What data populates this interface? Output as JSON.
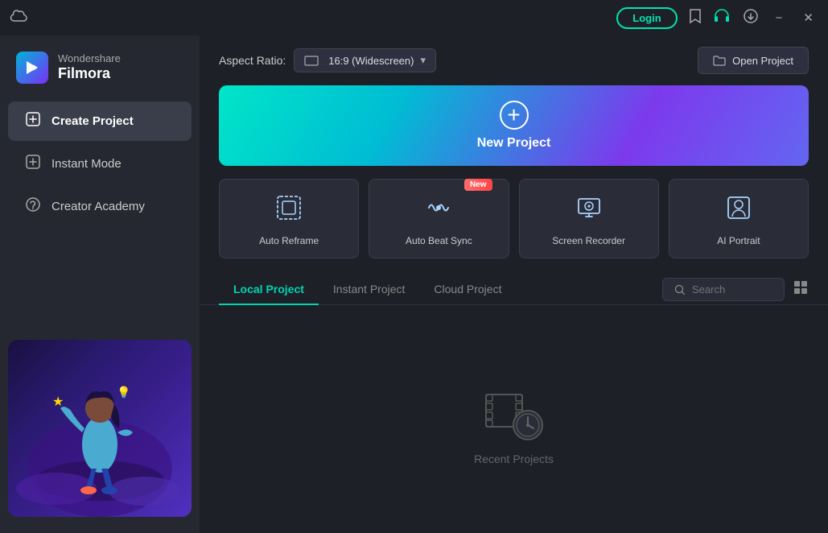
{
  "app": {
    "brand": "Wondershare",
    "product": "Filmora"
  },
  "titlebar": {
    "login_label": "Login",
    "minimize_label": "−",
    "close_label": "✕"
  },
  "sidebar": {
    "nav_items": [
      {
        "id": "create-project",
        "label": "Create Project",
        "active": true
      },
      {
        "id": "instant-mode",
        "label": "Instant Mode",
        "active": false
      },
      {
        "id": "creator-academy",
        "label": "Creator Academy",
        "active": false
      }
    ]
  },
  "toolbar": {
    "aspect_ratio_label": "Aspect Ratio:",
    "aspect_ratio_value": "16:9 (Widescreen)",
    "open_project_label": "Open Project"
  },
  "new_project": {
    "label": "New Project"
  },
  "feature_cards": [
    {
      "id": "auto-reframe",
      "label": "Auto Reframe",
      "badge": null
    },
    {
      "id": "auto-beat-sync",
      "label": "Auto Beat Sync",
      "badge": "New"
    },
    {
      "id": "screen-recorder",
      "label": "Screen Recorder",
      "badge": null
    },
    {
      "id": "ai-portrait",
      "label": "AI Portrait",
      "badge": null
    }
  ],
  "project_tabs": {
    "tabs": [
      {
        "id": "local-project",
        "label": "Local Project",
        "active": true
      },
      {
        "id": "instant-project",
        "label": "Instant Project",
        "active": false
      },
      {
        "id": "cloud-project",
        "label": "Cloud Project",
        "active": false
      }
    ],
    "search_placeholder": "Search"
  },
  "recent_projects": {
    "empty_label": "Recent Projects"
  }
}
